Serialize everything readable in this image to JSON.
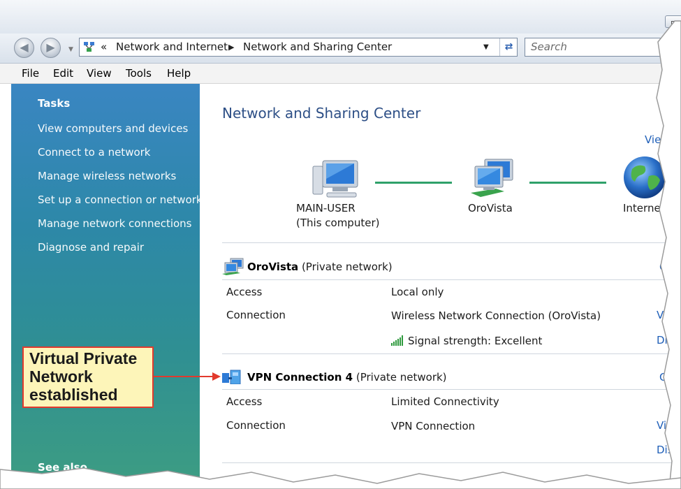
{
  "address": {
    "chevrons": "«",
    "crumbs": [
      "Network and Internet",
      "Network and Sharing Center"
    ]
  },
  "search": {
    "placeholder": "Search"
  },
  "menu": [
    "File",
    "Edit",
    "View",
    "Tools",
    "Help"
  ],
  "sidebar": {
    "heading": "Tasks",
    "items": [
      "View computers and devices",
      "Connect to a network",
      "Manage wireless networks",
      "Set up a connection or network",
      "Manage network connections",
      "Diagnose and repair"
    ],
    "see_also": "See also"
  },
  "main": {
    "title": "Network and Sharing Center",
    "view_full_map": "View fu",
    "map": {
      "computer_name": "MAIN-USER",
      "computer_sub": "(This computer)",
      "network_name": "OroVista",
      "internet": "Internet"
    },
    "networks": [
      {
        "name": "OroVista",
        "type": " (Private network)",
        "customize": "Cu",
        "rows": [
          {
            "label": "Access",
            "value": "Local only",
            "action": ""
          },
          {
            "label": "Connection",
            "value": "Wireless Network Connection (OroVista)",
            "action": "View"
          },
          {
            "label": "",
            "value": "Signal strength:  Excellent",
            "action": "Disco"
          }
        ]
      },
      {
        "name": "VPN Connection  4",
        "type": " (Private network)",
        "customize": "Cus",
        "rows": [
          {
            "label": "Access",
            "value": "Limited Connectivity",
            "action": ""
          },
          {
            "label": "Connection",
            "value": "VPN Connection",
            "action": "Vie"
          },
          {
            "label": "",
            "value": "",
            "action": "Disc"
          }
        ]
      }
    ]
  },
  "callout": {
    "lines": [
      "Virtual Private",
      "Network",
      "established"
    ]
  },
  "colors": {
    "accent": "#1f5fb8",
    "callout_border": "#e23a2d",
    "callout_fill": "#fdf5b9",
    "link_line": "#2fa16a"
  }
}
